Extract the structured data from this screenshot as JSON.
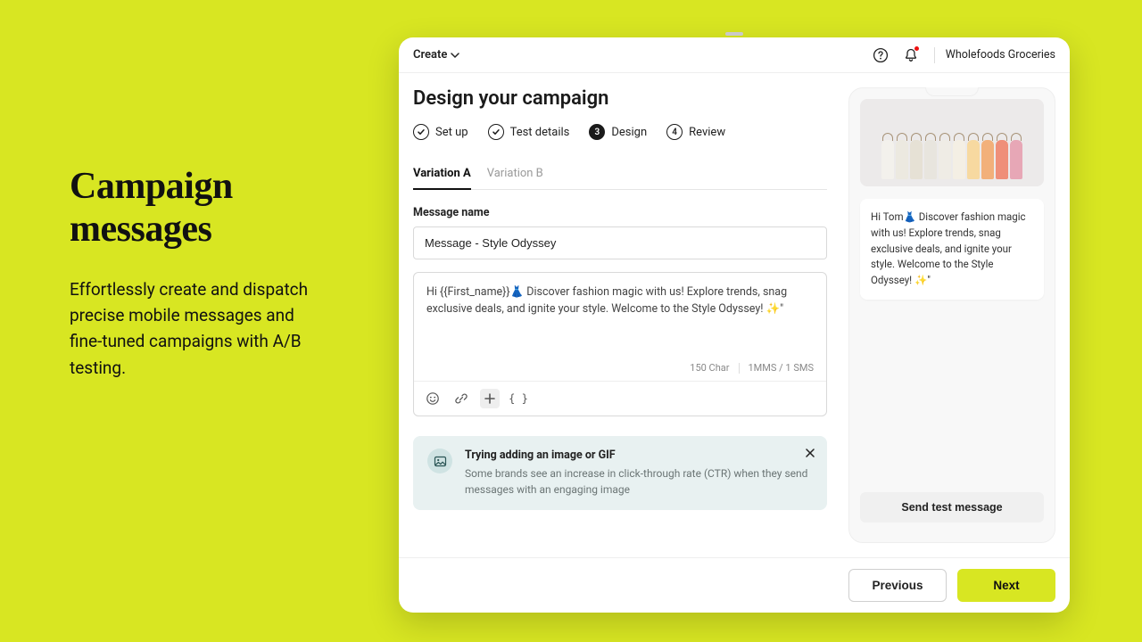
{
  "promo": {
    "title": "Campaign messages",
    "description": "Effortlessly create and dispatch precise mobile messages and fine-tuned campaigns with A/B testing."
  },
  "topbar": {
    "create_label": "Create",
    "org_name": "Wholefoods Groceries"
  },
  "page": {
    "title": "Design your campaign"
  },
  "steps": [
    {
      "label": "Set up",
      "state": "done"
    },
    {
      "label": "Test details",
      "state": "done"
    },
    {
      "label": "Design",
      "state": "active",
      "number": "3"
    },
    {
      "label": "Review",
      "state": "todo",
      "number": "4"
    }
  ],
  "tabs": [
    {
      "label": "Variation A",
      "active": true
    },
    {
      "label": "Variation  B",
      "active": false
    }
  ],
  "message_name": {
    "label": "Message name",
    "value": "Message - Style Odyssey"
  },
  "composer": {
    "body": "Hi {{First_name}}👗 Discover fashion magic with us! Explore trends, snag exclusive deals, and ignite your style. Welcome to the Style Odyssey! ✨\"",
    "char_count": "150 Char",
    "sms_count": "1MMS / 1 SMS"
  },
  "tip": {
    "title": "Trying adding an image or GIF",
    "description": "Some brands see an increase in click-through rate (CTR) when they send messages with an engaging image"
  },
  "preview": {
    "message": "Hi Tom👗 Discover fashion magic with us! Explore trends, snag exclusive deals, and ignite your style. Welcome to the Style Odyssey! ✨\"",
    "send_test_label": "Send test message",
    "shirt_colors": [
      "#f3f1ec",
      "#ece9e0",
      "#e6e1d5",
      "#e8e5de",
      "#efece5",
      "#f4efe4",
      "#f7d9a0",
      "#f2b07a",
      "#ef8f79",
      "#e7a7b6"
    ]
  },
  "footer": {
    "previous": "Previous",
    "next": "Next"
  }
}
